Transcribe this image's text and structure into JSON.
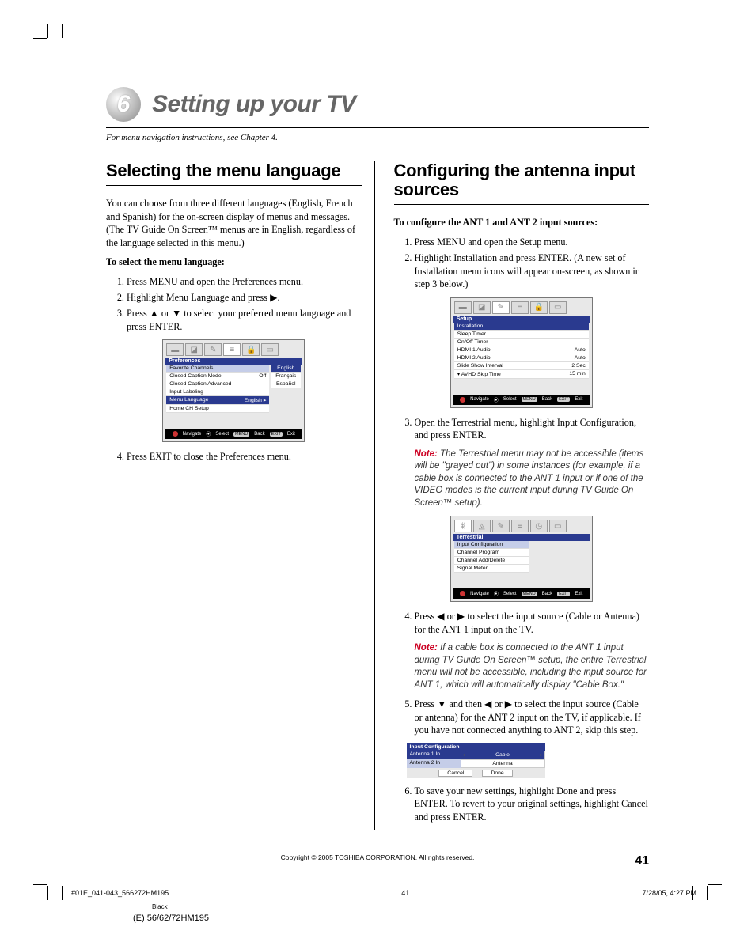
{
  "chapter": {
    "number": "6",
    "title": "Setting up your TV"
  },
  "nav_note": "For menu navigation instructions, see Chapter 4.",
  "left": {
    "heading": "Selecting the menu language",
    "intro": "You can choose from three different languages (English, French and Spanish) for the on-screen display of menus and messages. (The TV Guide On Screen™ menus are in English, regardless of the language selected in this menu.)",
    "subhead": "To select the menu language:",
    "steps": {
      "s1": "Press MENU and open the Preferences menu.",
      "s2a": "Highlight Menu Language and press ",
      "s2b": ".",
      "s3a": "Press ",
      "s3b": " or ",
      "s3c": " to select your preferred menu language and press ENTER.",
      "s4": "Press EXIT to close the Preferences menu."
    },
    "ss": {
      "title": "Preferences",
      "rows": {
        "r1": "Favorite Channels",
        "r2": "Closed Caption Mode",
        "r2v": "Off",
        "r3": "Closed Caption Advanced",
        "r4": "Input Labeling",
        "r5": "Menu Language",
        "r5v": "English",
        "r6": "Home CH Setup"
      },
      "opts": {
        "o1": "English",
        "o2": "Français",
        "o3": "Español"
      },
      "foot": {
        "nav": "Navigate",
        "sel": "Select",
        "back": "Back",
        "exit": "Exit",
        "menu": "MENU",
        "ex": "EXIT"
      }
    }
  },
  "right": {
    "heading": "Configuring the antenna input sources",
    "subhead": "To configure the ANT 1 and ANT 2 input sources:",
    "steps": {
      "s1": "Press MENU and open the Setup menu.",
      "s2": "Highlight Installation and press ENTER. (A new set of Installation menu icons will appear on-screen, as shown in step 3 below.)",
      "s3": "Open the Terrestrial menu, highlight Input Configuration, and press ENTER.",
      "s4a": "Press ",
      "s4b": " or ",
      "s4c": " to select the input source (Cable or Antenna) for the ANT 1 input on the TV.",
      "s5a": "Press ",
      "s5b": " and then ",
      "s5c": " or ",
      "s5d": " to select the input source (Cable or antenna) for the ANT 2 input on the TV, if applicable. If you have not connected anything to ANT 2, skip this step.",
      "s6": "To save your new settings, highlight Done and press ENTER. To revert to your original settings, highlight Cancel and press ENTER."
    },
    "note1": "The Terrestrial menu may not be accessible (items will be \"grayed out\") in some instances (for example, if a cable box is connected to the ANT 1 input or if one of the VIDEO modes is the current input during TV Guide On Screen™ setup).",
    "note2": "If a cable box is connected to the ANT 1 input during TV Guide On Screen™ setup, the entire Terrestrial menu will not be accessible, including the input source for ANT 1, which will automatically display \"Cable Box.\"",
    "note_label": "Note:",
    "ss1": {
      "title": "Setup",
      "rows": {
        "r1": "Installation",
        "r2": "Sleep Timer",
        "r3": "On/Off Timer",
        "r4": "HDMI 1 Audio",
        "r4v": "Auto",
        "r5": "HDMI 2 Audio",
        "r5v": "Auto",
        "r6": "Slide Show Interval",
        "r6v": "2 Sec",
        "r7": "AVHD Skip Time",
        "r7v": "15 min"
      }
    },
    "ss2": {
      "title": "Terrestrial",
      "rows": {
        "r1": "Input Configuration",
        "r2": "Channel Program",
        "r3": "Channel Add/Delete",
        "r4": "Signal Meter"
      }
    },
    "ic": {
      "title": "Input Configuration",
      "r1l": "Antenna 1 In",
      "r1v": "Cable",
      "r2l": "Antenna 2 In",
      "r2v": "Antenna",
      "cancel": "Cancel",
      "done": "Done"
    }
  },
  "arrows": {
    "right": "▶",
    "left": "◀",
    "up": "▲",
    "down": "▼"
  },
  "copyright": "Copyright © 2005 TOSHIBA CORPORATION. All rights reserved.",
  "page_number": "41",
  "footer": {
    "file": "#01E_041-043_566272HM195",
    "pg": "41",
    "date": "7/28/05, 4:27 PM",
    "black": "Black",
    "model": "(E) 56/62/72HM195"
  }
}
